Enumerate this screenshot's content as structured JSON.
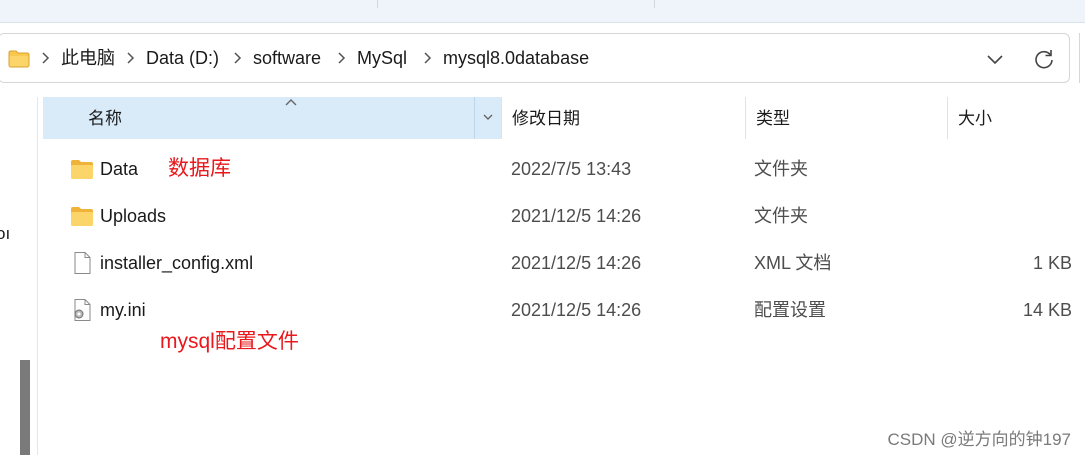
{
  "address_bar": {
    "folder_icon": "folder-icon",
    "breadcrumbs": [
      "此电脑",
      "Data (D:)",
      "software",
      "MySql",
      "mysql8.0database"
    ],
    "dropdown_icon": "chevron-down-icon",
    "refresh_icon": "refresh-icon"
  },
  "nav": {
    "partial_text": "oı"
  },
  "columns": {
    "name": "名称",
    "date": "修改日期",
    "type": "类型",
    "size": "大小"
  },
  "files": [
    {
      "name": "Data",
      "date": "2022/7/5 13:43",
      "type": "文件夹",
      "size": "",
      "icon": "folder-icon"
    },
    {
      "name": "Uploads",
      "date": "2021/12/5 14:26",
      "type": "文件夹",
      "size": "",
      "icon": "folder-icon"
    },
    {
      "name": "installer_config.xml",
      "date": "2021/12/5 14:26",
      "type": "XML 文档",
      "size": "1 KB",
      "icon": "file-icon"
    },
    {
      "name": "my.ini",
      "date": "2021/12/5 14:26",
      "type": "配置设置",
      "size": "14 KB",
      "icon": "config-file-icon"
    }
  ],
  "annotations": {
    "data_note": "数据库",
    "ini_note": "mysql配置文件"
  },
  "watermark": "CSDN @逆方向的钟197",
  "colors": {
    "annotation": "#e8181c",
    "header_selected": "#d9ebf9",
    "folder": "#f8c851"
  }
}
